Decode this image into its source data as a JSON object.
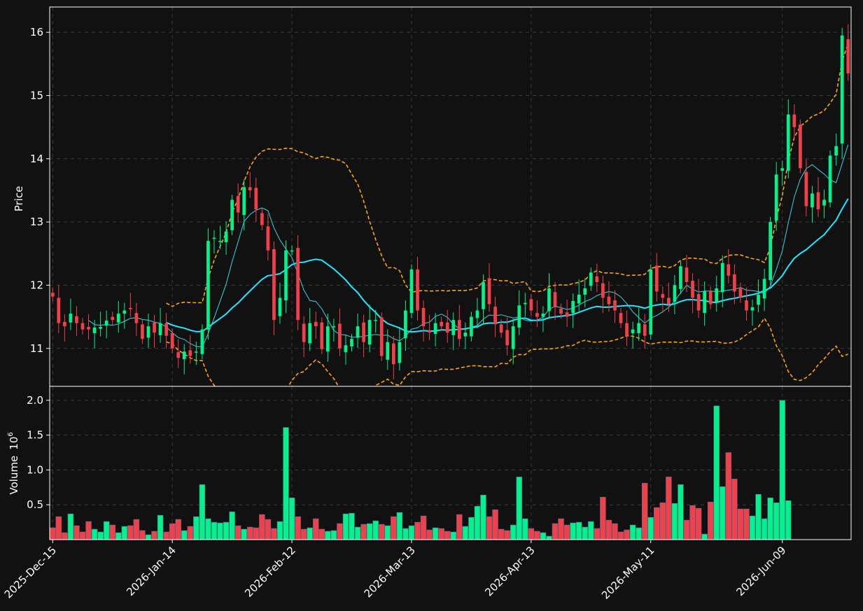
{
  "chart_data": {
    "type": "candlestick",
    "x_tick_labels": [
      "2025-Dec-15",
      "2026-Jan-14",
      "2026-Feb-12",
      "2026-Mar-13",
      "2026-Apr-13",
      "2026-May-11",
      "2026-Jun-09"
    ],
    "price_panel": {
      "ylabel": "Price",
      "ylim": [
        10.4,
        16.4
      ],
      "yticks": [
        11,
        12,
        13,
        14,
        15,
        16
      ],
      "grid": true
    },
    "volume_panel": {
      "ylabel": "Volume",
      "exponent_label": "10",
      "exponent_power": "6",
      "ylim": [
        0,
        2.2
      ],
      "yticks": [
        0.5,
        1.0,
        1.5,
        2.0
      ],
      "ytick_labels": [
        "0.5",
        "1.0",
        "1.5",
        "2.0"
      ],
      "grid": true
    },
    "colors": {
      "up": "#00f28a",
      "down": "#f2404a",
      "ma_short": "#33d6e0",
      "ma_long": "#1ee8ff",
      "band": "#ffa500",
      "background": "#111111",
      "grid": "#3a3a3a",
      "frame": "#ffffff"
    },
    "close": [
      11.82,
      11.4,
      11.35,
      11.55,
      11.4,
      11.3,
      11.3,
      11.33,
      11.34,
      11.44,
      11.45,
      11.55,
      11.6,
      11.62,
      11.4,
      11.15,
      11.35,
      11.25,
      11.4,
      11.2,
      11.0,
      10.85,
      10.95,
      10.88,
      10.95,
      11.3,
      12.7,
      12.75,
      12.7,
      12.85,
      13.35,
      13.15,
      13.55,
      13.5,
      13.2,
      12.95,
      12.55,
      11.45,
      11.8,
      12.55,
      12.55,
      11.45,
      11.1,
      11.4,
      11.35,
      10.99,
      11.35,
      11.35,
      11.0,
      11.05,
      11.15,
      11.35,
      11.1,
      11.45,
      11.45,
      10.88,
      11.1,
      10.75,
      11.1,
      11.6,
      12.25,
      11.6,
      11.35,
      11.25,
      11.4,
      11.35,
      11.25,
      11.45,
      11.15,
      11.25,
      11.5,
      11.6,
      12.05,
      11.7,
      11.38,
      11.25,
      11.05,
      11.35,
      11.68,
      11.72,
      11.6,
      11.5,
      11.55,
      11.95,
      11.65,
      11.55,
      11.5,
      11.75,
      11.85,
      11.95,
      12.2,
      12.05,
      11.8,
      11.7,
      11.6,
      11.4,
      11.2,
      11.3,
      11.4,
      11.2,
      12.25,
      11.9,
      11.8,
      11.7,
      12.0,
      12.3,
      12.05,
      11.8,
      11.6,
      11.9,
      11.7,
      11.95,
      12.35,
      12.15,
      11.9,
      11.8,
      11.6,
      11.65,
      11.85,
      12.1,
      13.0,
      13.75,
      13.85,
      14.7,
      14.5,
      13.85,
      13.25,
      13.45,
      13.2,
      13.35,
      14.05,
      14.2,
      15.95,
      15.35
    ],
    "volume": [
      0.17,
      0.33,
      0.1,
      0.37,
      0.2,
      0.11,
      0.26,
      0.15,
      0.11,
      0.26,
      0.21,
      0.1,
      0.19,
      0.2,
      0.29,
      0.13,
      0.07,
      0.12,
      0.35,
      0.11,
      0.23,
      0.29,
      0.13,
      0.19,
      0.33,
      0.79,
      0.3,
      0.25,
      0.24,
      0.25,
      0.4,
      0.2,
      0.15,
      0.18,
      0.17,
      0.36,
      0.29,
      0.16,
      0.26,
      1.61,
      0.6,
      0.33,
      0.15,
      0.17,
      0.3,
      0.15,
      0.12,
      0.13,
      0.23,
      0.37,
      0.38,
      0.18,
      0.22,
      0.23,
      0.27,
      0.22,
      0.2,
      0.33,
      0.39,
      0.16,
      0.2,
      0.25,
      0.34,
      0.14,
      0.17,
      0.16,
      0.12,
      0.11,
      0.36,
      0.19,
      0.32,
      0.48,
      0.64,
      0.33,
      0.43,
      0.15,
      0.13,
      0.21,
      0.9,
      0.3,
      0.16,
      0.12,
      0.1,
      0.05,
      0.23,
      0.3,
      0.21,
      0.24,
      0.25,
      0.18,
      0.26,
      0.16,
      0.61,
      0.28,
      0.23,
      0.11,
      0.14,
      0.21,
      0.17,
      0.81,
      0.32,
      0.46,
      0.53,
      0.9,
      0.52,
      0.79,
      0.28,
      0.49,
      0.45,
      0.08,
      0.54,
      1.92,
      0.76,
      1.25,
      0.87,
      0.44,
      0.44,
      0.34,
      0.65,
      0.3,
      0.6,
      0.53,
      2.0,
      0.56
    ]
  }
}
